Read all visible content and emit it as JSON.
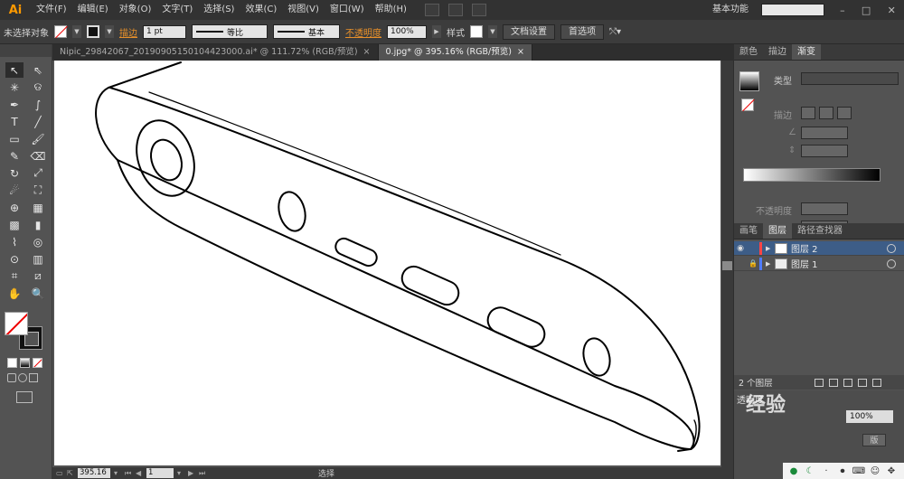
{
  "app": {
    "logo": "Ai"
  },
  "menu": [
    "文件(F)",
    "编辑(E)",
    "对象(O)",
    "文字(T)",
    "选择(S)",
    "效果(C)",
    "视图(V)",
    "窗口(W)",
    "帮助(H)"
  ],
  "workspace": "基本功能",
  "control": {
    "no_selection": "未选择对象",
    "stroke_label": "描边",
    "stroke_weight": "1 pt",
    "profile_label": "等比",
    "brush_label": "基本",
    "opacity_label": "不透明度",
    "opacity_value": "100%",
    "style_label": "样式",
    "doc_setup": "文档设置",
    "preferences": "首选项"
  },
  "tabs": [
    {
      "label": "Nipic_29842067_20190905150104423000.ai* @ 111.72% (RGB/预览)",
      "close": "×"
    },
    {
      "label": "0.jpg* @ 395.16% (RGB/预览)",
      "close": "×"
    }
  ],
  "status": {
    "zoom": "395.16",
    "page": "1",
    "tool": "选择"
  },
  "panel_top": {
    "tabs": [
      "颜色",
      "描边",
      "渐变"
    ],
    "type_label": "类型",
    "stroke_label": "描边",
    "opacity_label": "不透明度",
    "position_label": "位置"
  },
  "panel_layers": {
    "tabs": [
      "画笔",
      "图层",
      "路径查找器"
    ],
    "layers": [
      {
        "name": "图层 2",
        "color": "#ff4444"
      },
      {
        "name": "图层 1",
        "color": "#4f7bff"
      }
    ],
    "count": "2 个图层"
  },
  "panel_transparency": {
    "tab": "透明度",
    "value": "100%",
    "button": "版"
  },
  "watermark": "经验"
}
